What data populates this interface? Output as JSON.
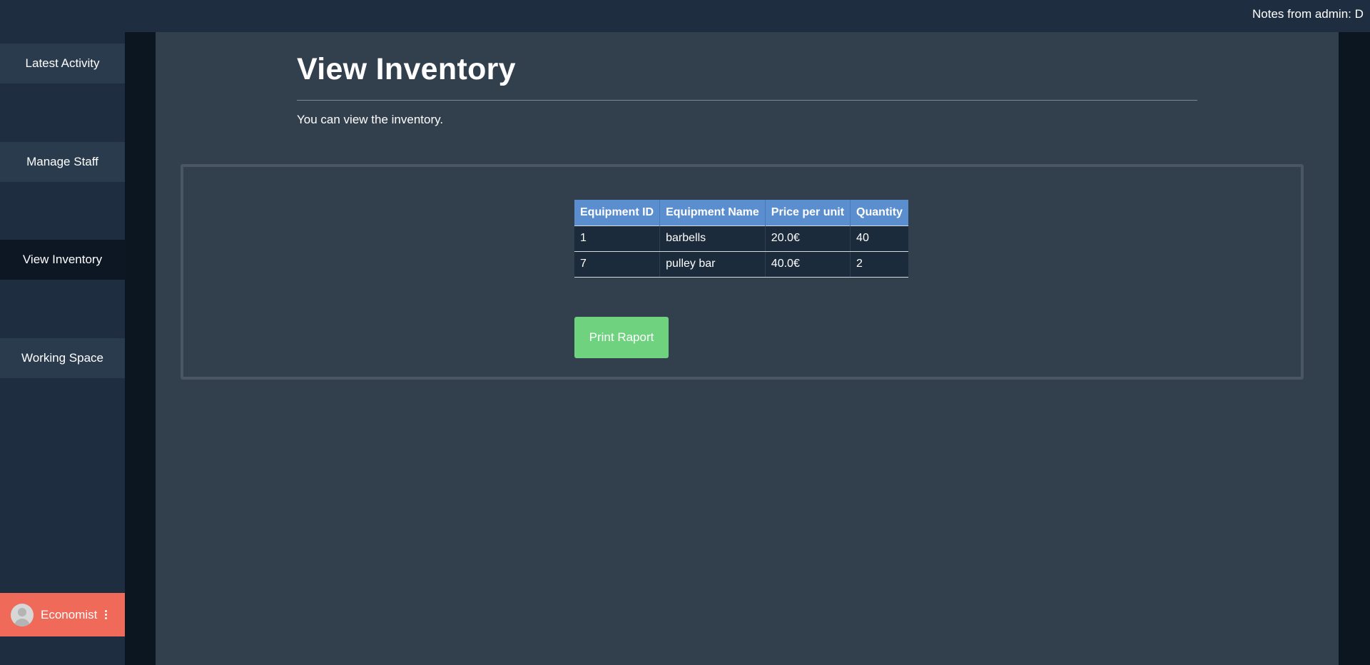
{
  "topbar": {
    "notes": "Notes from admin: D"
  },
  "sidebar": {
    "items": [
      {
        "label": "Latest Activity"
      },
      {
        "label": "Manage Staff"
      },
      {
        "label": "View Inventory"
      },
      {
        "label": "Working Space"
      }
    ],
    "active_item": "View Inventory",
    "user": {
      "name": "Economist"
    }
  },
  "main": {
    "title": "View Inventory",
    "subtitle": "You can view the inventory.",
    "table": {
      "headers": [
        "Equipment ID",
        "Equipment Name",
        "Price per unit",
        "Quantity"
      ],
      "rows": [
        [
          "1",
          "barbells",
          "20.0€",
          "40"
        ],
        [
          "7",
          "pulley bar",
          "40.0€",
          "2"
        ]
      ]
    },
    "print_button_label": "Print Raport"
  },
  "colors": {
    "sidebar_bg": "#1e2d40",
    "active_nav_bg": "#0d1724",
    "main_bg": "#323f4d",
    "table_header_bg": "#5b8ecf",
    "user_box_bg": "#ef6a59",
    "print_button_bg": "#6fd27f"
  },
  "icons": {
    "avatar": "user-avatar-icon",
    "user_menu": "kebab-menu-icon"
  }
}
